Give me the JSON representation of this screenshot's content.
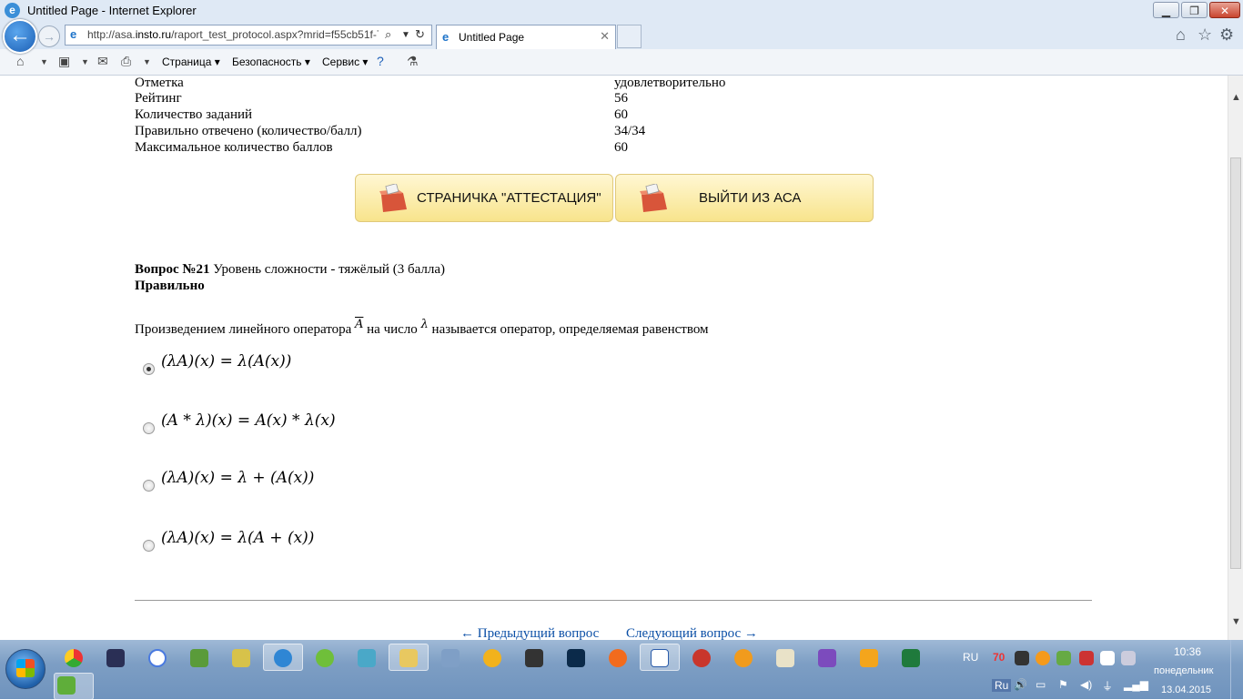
{
  "window": {
    "title": "Untitled Page - Internet Explorer"
  },
  "nav": {
    "url_prefix": "http://asa.",
    "url_domain": "insto.ru",
    "url_rest": "/raport_test_protocol.aspx?mrid=f55cb51f-7",
    "tab_title": "Untitled Page"
  },
  "commandbar": {
    "page_label": "Страница",
    "safety_label": "Безопасность",
    "tools_label": "Сервис"
  },
  "stats": [
    {
      "label": "Отметка",
      "value": "удовлетворительно"
    },
    {
      "label": "Рейтинг",
      "value": "56"
    },
    {
      "label": "Количество заданий",
      "value": "60"
    },
    {
      "label": "Правильно отвечено (количество/балл)",
      "value": "34/34"
    },
    {
      "label": "Максимальное количество баллов",
      "value": "60"
    }
  ],
  "buttons": {
    "attestation": "СТРАНИЧКА \"АТТЕСТАЦИЯ\"",
    "exit": "ВЫЙТИ ИЗ АСА"
  },
  "question": {
    "number_label": "Вопрос №21",
    "difficulty": "Уровень сложности - тяжёлый (3 балла)",
    "result": "Правильно",
    "text_part1": "Произведением линейного оператора",
    "operator_symbol": "A",
    "text_part2": "на число",
    "lambda_symbol": "λ",
    "text_part3": "называется оператор, определяемая равенством",
    "options": [
      {
        "formula": "(λA)(x) = λ(A(x))",
        "selected": true
      },
      {
        "formula": "(A * λ)(x) = A(x) * λ(x)",
        "selected": false
      },
      {
        "formula": "(λA)(x) = λ + (A(x))",
        "selected": false
      },
      {
        "formula": "(λA)(x) = λ(A + (x))",
        "selected": false
      }
    ]
  },
  "pagination": {
    "prev": "← Предыдущий вопрос",
    "next": "Следующий вопрос →"
  },
  "tray": {
    "lang": "RU",
    "lang2": "Ru",
    "badge": "70",
    "time": "10:36",
    "day": "понедельник",
    "date": "13.04.2015"
  }
}
